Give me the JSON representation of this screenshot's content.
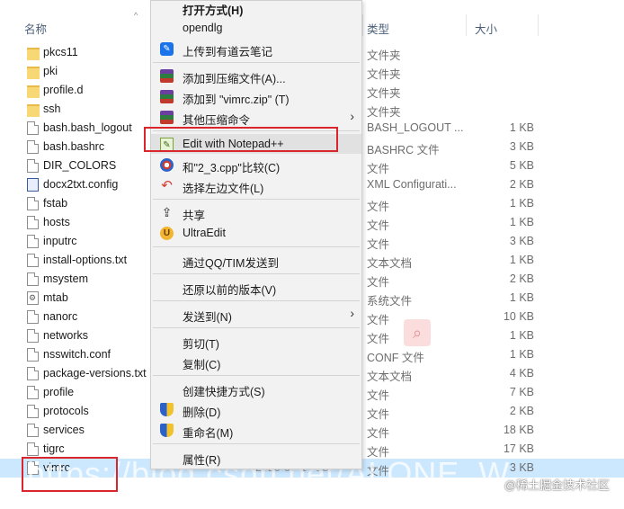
{
  "columns": {
    "name": "名称",
    "type": "类型",
    "size": "大小"
  },
  "files": [
    {
      "name": "pkcs11",
      "type": "文件夹",
      "size": "",
      "icon": "folder-icon"
    },
    {
      "name": "pki",
      "type": "文件夹",
      "size": "",
      "icon": "folder-icon"
    },
    {
      "name": "profile.d",
      "type": "文件夹",
      "size": "",
      "icon": "folder-icon"
    },
    {
      "name": "ssh",
      "type": "文件夹",
      "size": "",
      "icon": "folder-icon"
    },
    {
      "name": "bash.bash_logout",
      "type": "BASH_LOGOUT ...",
      "size": "1 KB",
      "icon": "file-icon"
    },
    {
      "name": "bash.bashrc",
      "type": "BASHRC 文件",
      "size": "3 KB",
      "icon": "file-icon"
    },
    {
      "name": "DIR_COLORS",
      "type": "文件",
      "size": "5 KB",
      "icon": "file-icon"
    },
    {
      "name": "docx2txt.config",
      "type": "XML Configurati...",
      "size": "2 KB",
      "icon": "config-file-icon"
    },
    {
      "name": "fstab",
      "type": "文件",
      "size": "1 KB",
      "icon": "file-icon"
    },
    {
      "name": "hosts",
      "type": "文件",
      "size": "1 KB",
      "icon": "file-icon"
    },
    {
      "name": "inputrc",
      "type": "文件",
      "size": "3 KB",
      "icon": "file-icon"
    },
    {
      "name": "install-options.txt",
      "type": "文本文档",
      "size": "1 KB",
      "icon": "file-icon"
    },
    {
      "name": "msystem",
      "type": "文件",
      "size": "2 KB",
      "icon": "file-icon"
    },
    {
      "name": "mtab",
      "type": "系统文件",
      "size": "1 KB",
      "icon": "system-file-icon"
    },
    {
      "name": "nanorc",
      "type": "文件",
      "size": "10 KB",
      "icon": "file-icon"
    },
    {
      "name": "networks",
      "type": "文件",
      "size": "1 KB",
      "icon": "file-icon"
    },
    {
      "name": "nsswitch.conf",
      "type": "CONF 文件",
      "size": "1 KB",
      "icon": "file-icon"
    },
    {
      "name": "package-versions.txt",
      "type": "文本文档",
      "size": "4 KB",
      "icon": "file-icon"
    },
    {
      "name": "profile",
      "type": "文件",
      "size": "7 KB",
      "icon": "file-icon"
    },
    {
      "name": "protocols",
      "type": "文件",
      "size": "2 KB",
      "icon": "file-icon"
    },
    {
      "name": "services",
      "type": "文件",
      "size": "18 KB",
      "icon": "file-icon"
    },
    {
      "name": "tigrc",
      "type": "文件",
      "size": "17 KB",
      "icon": "file-icon"
    },
    {
      "name": "vimrc",
      "type": "文件",
      "size": "3 KB",
      "icon": "file-icon",
      "date": "2020-09-14 18:",
      "selected": true
    }
  ],
  "context_menu": {
    "items": [
      {
        "label": "打开方式(H)",
        "bold": true,
        "icon": ""
      },
      {
        "label": "opendlg",
        "icon": ""
      },
      {
        "label": "上传到有道云笔记",
        "icon": "youdao-note-icon"
      },
      {
        "sep": true
      },
      {
        "label": "添加到压缩文件(A)...",
        "icon": "winrar-icon"
      },
      {
        "label": "添加到 \"vimrc.zip\" (T)",
        "icon": "winrar-icon"
      },
      {
        "label": "其他压缩命令",
        "icon": "winrar-icon",
        "submenu": true
      },
      {
        "sep": true
      },
      {
        "label": "Edit with Notepad++",
        "icon": "notepadpp-icon",
        "hover": true
      },
      {
        "label": "和\"2_3.cpp\"比较(C)",
        "icon": "beyond-compare-icon"
      },
      {
        "label": "选择左边文件(L)",
        "icon": "undo-arrow-icon"
      },
      {
        "sep": true
      },
      {
        "label": "共享",
        "icon": "share-icon"
      },
      {
        "label": "UltraEdit",
        "icon": "ultraedit-icon"
      },
      {
        "sep": true
      },
      {
        "label": "通过QQ/TIM发送到",
        "icon": ""
      },
      {
        "sep": true
      },
      {
        "label": "还原以前的版本(V)",
        "icon": ""
      },
      {
        "sep": true
      },
      {
        "label": "发送到(N)",
        "icon": "",
        "submenu": true
      },
      {
        "sep": true
      },
      {
        "label": "剪切(T)",
        "icon": ""
      },
      {
        "label": "复制(C)",
        "icon": ""
      },
      {
        "sep": true
      },
      {
        "label": "创建快捷方式(S)",
        "icon": ""
      },
      {
        "label": "删除(D)",
        "icon": "shield-icon"
      },
      {
        "label": "重命名(M)",
        "icon": "shield-icon"
      },
      {
        "sep": true
      },
      {
        "label": "属性(R)",
        "icon": ""
      }
    ]
  },
  "watermark": {
    "url": "https://blog.csdn.net/ALONE_W",
    "corner": "@稀土掘金技术社区"
  },
  "colors": {
    "highlight_box": "#d9262c",
    "selection": "#cce8ff",
    "menu_bg": "#f2f2f2",
    "menu_hover": "#e1e1e1"
  }
}
